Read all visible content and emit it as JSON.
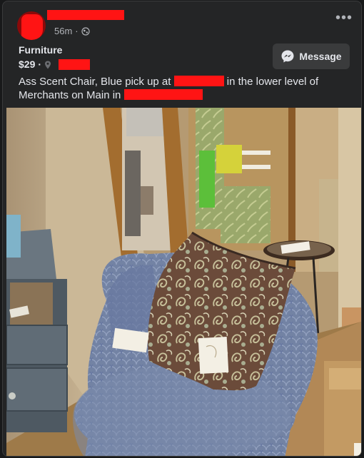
{
  "post": {
    "time_ago": "56m",
    "separator": "·",
    "audience_icon": "globe-icon",
    "more_icon": "more-options-icon",
    "category": "Furniture",
    "price": "$29",
    "location_icon": "map-pin-icon",
    "message_button": {
      "label": "Message",
      "icon": "messenger-icon"
    },
    "description": {
      "part1": "Ass Scent Chair, Blue pick up at ",
      "part2": " in the lower level of",
      "part3": "Merchants on Main in "
    },
    "photo": {
      "subject": "blue upholstered accent chair with paisley pillow"
    }
  },
  "colors": {
    "card_background": "#242526",
    "page_background": "#18191a",
    "text_primary": "#e4e6eb",
    "text_secondary": "#b0b3b8",
    "button_background": "#3a3b3c",
    "redaction": "#ff1414"
  }
}
